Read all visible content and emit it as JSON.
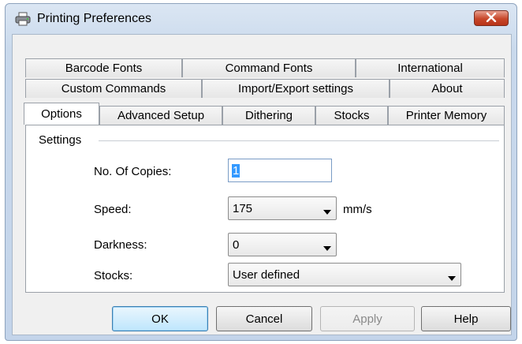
{
  "window": {
    "title": "Printing Preferences",
    "title_icon": "printer-icon",
    "close_icon": "close-icon",
    "close_color": "#c7472a"
  },
  "tabs": {
    "row1": [
      "Barcode Fonts",
      "Command Fonts",
      "International"
    ],
    "row2": [
      "Custom Commands",
      "Import/Export settings",
      "About"
    ],
    "row3": [
      "Options",
      "Advanced Setup",
      "Dithering",
      "Stocks",
      "Printer Memory"
    ],
    "active": "Options"
  },
  "settings": {
    "group_label": "Settings",
    "copies_label": "No. Of Copies:",
    "copies_value": "1",
    "speed_label": "Speed:",
    "speed_value": "175",
    "speed_units": "mm/s",
    "darkness_label": "Darkness:",
    "darkness_value": "0",
    "stocks_label": "Stocks:",
    "stocks_value": "User defined"
  },
  "buttons": {
    "ok": "OK",
    "cancel": "Cancel",
    "apply": "Apply",
    "help": "Help"
  }
}
